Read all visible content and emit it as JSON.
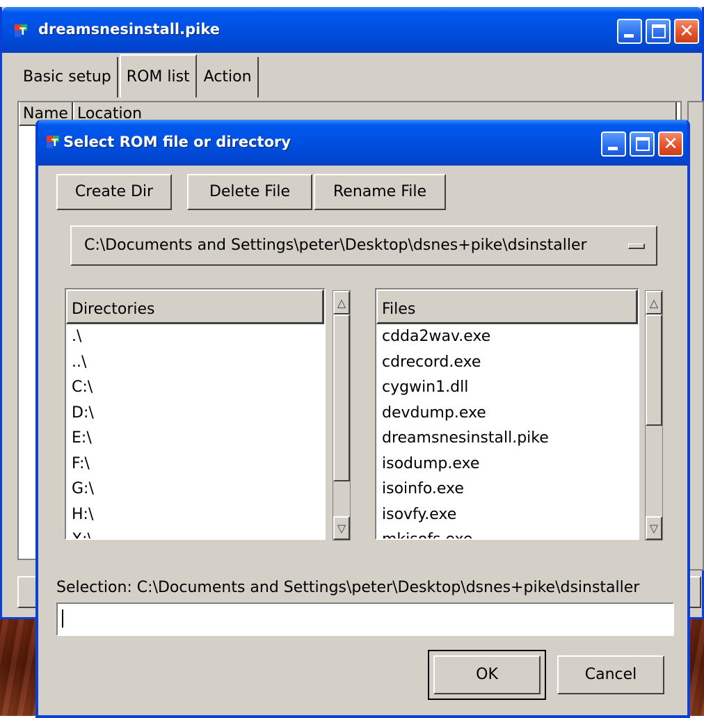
{
  "main_window": {
    "title": "dreamsnesinstall.pike",
    "tabs": [
      {
        "label": "Basic setup"
      },
      {
        "label": "ROM list"
      },
      {
        "label": "Action"
      }
    ],
    "list_columns": [
      "Name",
      "Location"
    ]
  },
  "dialog": {
    "title": "Select ROM file or directory",
    "toolbar": {
      "create_dir": "Create Dir",
      "delete_file": "Delete File",
      "rename_file": "Rename File"
    },
    "path_dropdown": {
      "selected": "C:\\Documents and Settings\\peter\\Desktop\\dsnes+pike\\dsinstaller"
    },
    "directories": {
      "header": "Directories",
      "items": [
        ".\\",
        "..\\",
        "C:\\",
        "D:\\",
        "E:\\",
        "F:\\",
        "G:\\",
        "H:\\",
        "X:\\"
      ]
    },
    "files": {
      "header": "Files",
      "items": [
        "cdda2wav.exe",
        "cdrecord.exe",
        "cygwin1.dll",
        "devdump.exe",
        "dreamsnesinstall.pike",
        "isodump.exe",
        "isoinfo.exe",
        "isovfy.exe",
        "mkisofs.exe"
      ]
    },
    "selection_label": "Selection: C:\\Documents and Settings\\peter\\Desktop\\dsnes+pike\\dsinstaller",
    "selection_value": "",
    "ok": "OK",
    "cancel": "Cancel"
  },
  "colors": {
    "titlebar": "#0054e3",
    "face": "#d4d0c8"
  }
}
